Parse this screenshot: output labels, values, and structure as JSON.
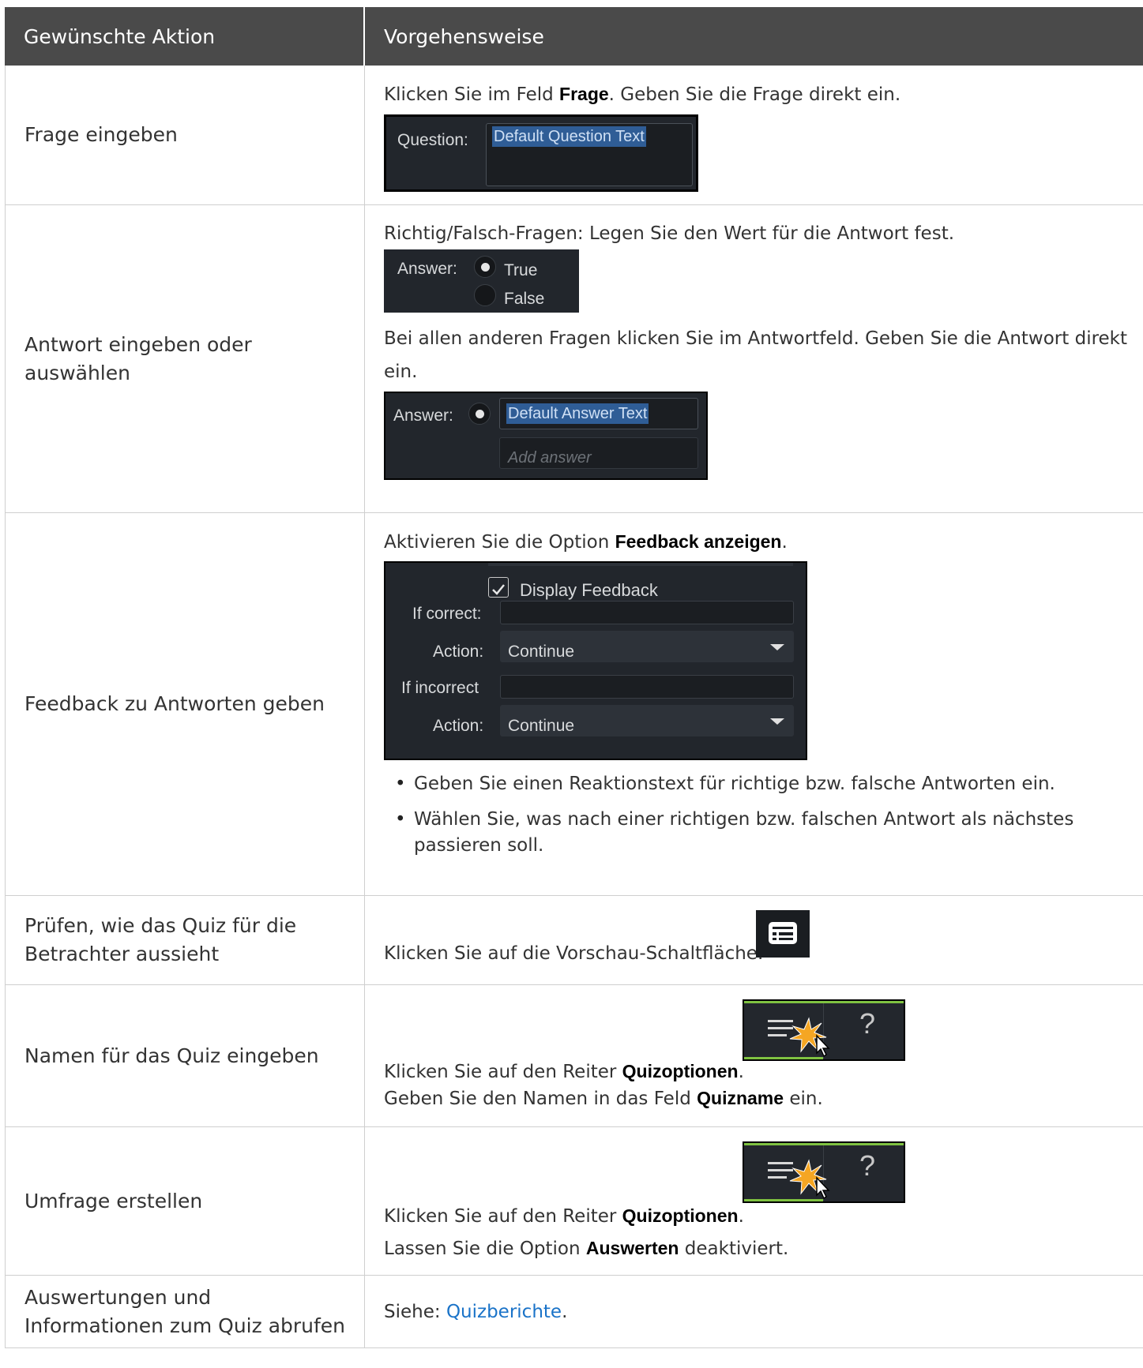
{
  "header": {
    "col1": "Gewünschte Aktion",
    "col2": "Vorgehensweise"
  },
  "rows": {
    "r1": {
      "action": "Frage eingeben",
      "text_pre": "Klicken Sie im Feld ",
      "text_bold": "Frage",
      "text_post": ". Geben Sie die Frage direkt ein.",
      "shot": {
        "label": "Question:",
        "value": "Default Question Text"
      }
    },
    "r2": {
      "action": "Antwort eingeben oder auswählen",
      "text1": "Richtig/Falsch-Fragen: Legen Sie den Wert für die Antwort fest.",
      "shot1": {
        "label": "Answer:",
        "opt_true": "True",
        "opt_false": "False"
      },
      "text2": "Bei allen anderen Fragen klicken Sie im Antwortfeld. Geben Sie die Antwort direkt ein.",
      "shot2": {
        "label": "Answer:",
        "value": "Default Answer Text",
        "placeholder": "Add answer"
      }
    },
    "r3": {
      "action": "Feedback zu Antworten geben",
      "text_pre": "Aktivieren Sie die Option ",
      "text_bold": "Feedback anzeigen",
      "text_post": ".",
      "shot": {
        "checkbox_label": "Display Feedback",
        "if_correct": "If correct:",
        "action1_label": "Action:",
        "action1_value": "Continue",
        "if_incorrect": "If incorrect",
        "action2_label": "Action:",
        "action2_value": "Continue"
      },
      "bullets": [
        "Geben Sie einen Reaktionstext für richtige bzw. falsche Antworten ein.",
        "Wählen Sie, was nach einer richtigen bzw. falschen Antwort als nächstes passieren soll."
      ]
    },
    "r4": {
      "action": "Prüfen, wie das Quiz für die Betrachter aussieht",
      "text": "Klicken Sie auf die Vorschau-Schaltfläche."
    },
    "r5": {
      "action": "Namen für das Quiz eingeben",
      "line1_pre": "Klicken Sie auf den Reiter ",
      "line1_bold": "Quizoptionen",
      "line1_post": ".",
      "line2_pre": "Geben Sie den Namen in das Feld ",
      "line2_bold": "Quizname",
      "line2_post": " ein.",
      "tab_question": "?"
    },
    "r6": {
      "action": "Umfrage erstellen",
      "line1_pre": "Klicken Sie auf den Reiter ",
      "line1_bold": "Quizoptionen",
      "line1_post": ".",
      "line2_pre": "Lassen Sie die Option ",
      "line2_bold": "Auswerten",
      "line2_post": " deaktiviert.",
      "tab_question": "?"
    },
    "r7": {
      "action": "Auswertungen und Informationen zum Quiz abrufen",
      "text_pre": "Siehe: ",
      "link": "Quizberichte",
      "text_post": "."
    }
  },
  "colors": {
    "header_bg": "#4a4a4a",
    "dark_ui": "#22262c",
    "link": "#1a73c8",
    "accent_green": "#7fc241",
    "burst": "#f5a623"
  }
}
